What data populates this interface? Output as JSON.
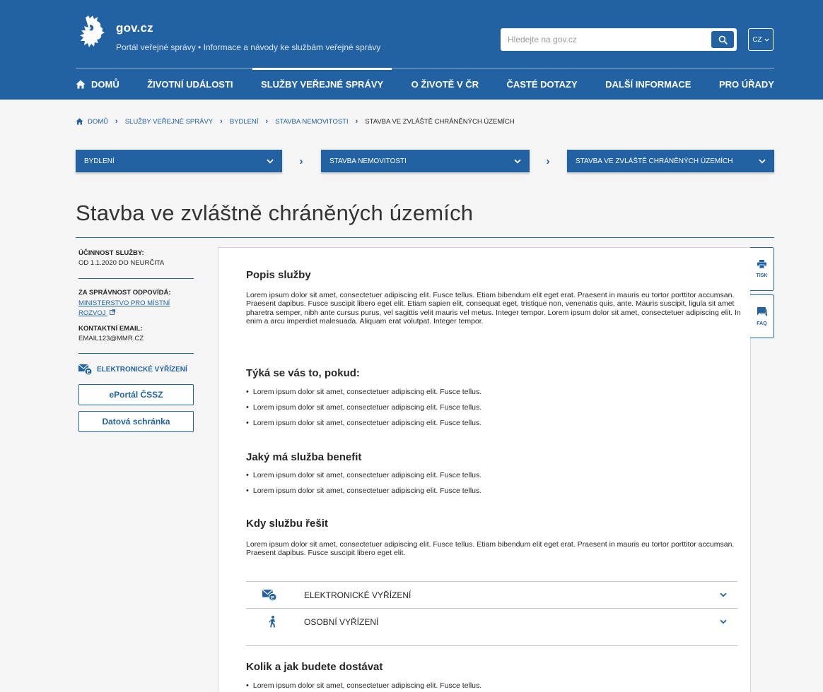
{
  "header": {
    "site_name": "gov.cz",
    "subtitle": "Portál veřejné správy • Informace a návody ke službám veřejné správy",
    "search_placeholder": "Hledejte na gov.cz",
    "lang": "CZ"
  },
  "nav": {
    "home": "Domů",
    "life_events": "Životní události",
    "services": "Služby veřejné správy",
    "life_cz": "O životě v ČR",
    "faq": "Časté dotazy",
    "more_info": "Další informace",
    "offices": "Pro úřady"
  },
  "breadcrumb": {
    "home": "Domů",
    "services": "Služby veřejné správy",
    "housing": "Bydlení",
    "construction": "Stavba nemovitosti",
    "current": "Stavba ve zvláště chráněných územích"
  },
  "selectors": {
    "first": "Bydlení",
    "second": "Stavba nemovitosti",
    "third": "Stavba ve zvláště chráněných územích"
  },
  "page": {
    "title": "Stavba ve zvláštně chráněných územích"
  },
  "sidebar": {
    "validity_label": "Účinnost služby:",
    "validity_value": "Od 1.1.2020 do neurčita",
    "responsible_label": "Za správnost odpovídá:",
    "responsible_link_1": "Ministerstvo pro místní",
    "responsible_link_2": "rozvoj",
    "email_label": "Kontaktní email:",
    "email_value": "email123@mmr.cz",
    "electronic_label": "Elektronické vyřízení",
    "btn_eportal": "ePortál ČSSZ",
    "btn_databox": "Datová schránka"
  },
  "content": {
    "s1_title": "Popis služby",
    "s1_text": "Lorem ipsum dolor sit amet, consectetuer adipiscing elit. Fusce tellus. Etiam bibendum elit eget erat. Praesent in mauris eu tortor porttitor accumsan. Praesent dapibus. Fusce suscipit libero eget elit. Etiam sapien elit, consequat eget, tristique non, venenatis quis, ante. Mauris suscipit, ligula sit amet pharetra semper, nibh ante cursus purus, vel sagittis velit mauris vel metus. Integer tempor. Lorem ipsum dolor sit amet, consectetuer adipiscing elit. In enim a arcu imperdiet malesuada. Aliquam erat volutpat. Integer tempor.",
    "s2_title": "Týká se vás to, pokud:",
    "s2_items": [
      "Lorem ipsum dolor sit amet, consectetuer adipiscing elit. Fusce tellus.",
      "Lorem ipsum dolor sit amet, consectetuer adipiscing elit. Fusce tellus.",
      "Lorem ipsum dolor sit amet, consectetuer adipiscing elit. Fusce tellus."
    ],
    "s3_title": "Jaký má služba benefit",
    "s3_items": [
      "Lorem ipsum dolor sit amet, consectetuer adipiscing elit. Fusce tellus.",
      "Lorem ipsum dolor sit amet, consectetuer adipiscing elit. Fusce tellus."
    ],
    "s4_title": "Kdy službu řešit",
    "s4_text": "Lorem ipsum dolor sit amet, consectetuer adipiscing elit. Fusce tellus. Etiam bibendum elit eget erat. Praesent in mauris eu tortor porttitor accumsan. Praesent dapibus. Fusce suscipit libero eget elit.",
    "acc_electronic": "Elektronické vyřízení",
    "acc_personal": "Osobní vyřízení",
    "s5_title": "Kolik a jak budete dostávat",
    "s5_items": [
      "Lorem ipsum dolor sit amet, consectetuer adipiscing elit. Fusce tellus."
    ]
  },
  "tools": {
    "print": "Tisk",
    "faq": "FAQ"
  },
  "colors": {
    "brand": "#2362a2",
    "background": "#f5f5f6"
  }
}
